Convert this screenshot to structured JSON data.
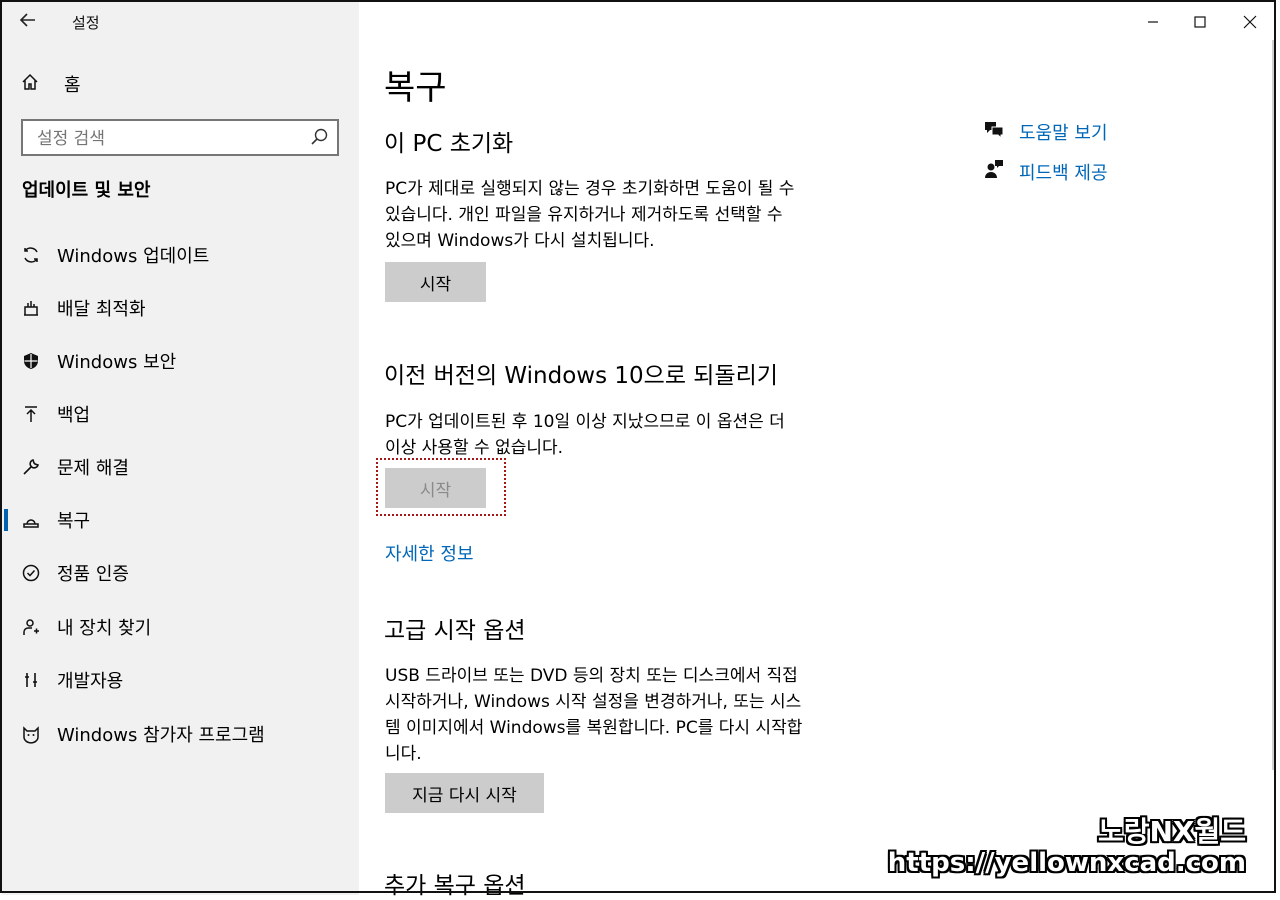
{
  "window": {
    "title": "설정",
    "controls": {
      "minimize": "—",
      "maximize": "☐",
      "close": "✕"
    }
  },
  "sidebar": {
    "home_label": "홈",
    "search_placeholder": "설정 검색",
    "section_title": "업데이트 및 보안",
    "items": [
      {
        "label": "Windows 업데이트",
        "icon": "refresh-icon"
      },
      {
        "label": "배달 최적화",
        "icon": "delivery-icon"
      },
      {
        "label": "Windows 보안",
        "icon": "shield-icon"
      },
      {
        "label": "백업",
        "icon": "backup-arrow-icon"
      },
      {
        "label": "문제 해결",
        "icon": "wrench-icon"
      },
      {
        "label": "복구",
        "icon": "recovery-icon",
        "active": true
      },
      {
        "label": "정품 인증",
        "icon": "check-circle-icon"
      },
      {
        "label": "내 장치 찾기",
        "icon": "person-locate-icon"
      },
      {
        "label": "개발자용",
        "icon": "developer-icon"
      },
      {
        "label": "Windows 참가자 프로그램",
        "icon": "insider-cat-icon"
      }
    ]
  },
  "main": {
    "page_title": "복구",
    "reset": {
      "heading": "이 PC 초기화",
      "line1": "PC가 제대로 실행되지 않는 경우 초기화하면 도움이 될 수",
      "line2": "있습니다. 개인 파일을 유지하거나 제거하도록 선택할 수",
      "line3": "있으며 Windows가 다시 설치됩니다.",
      "button": "시작"
    },
    "rollback": {
      "heading": "이전 버전의 Windows 10으로 되돌리기",
      "line1": "PC가 업데이트된 후 10일 이상 지났으므로 이 옵션은 더",
      "line2": "이상 사용할 수 없습니다.",
      "button": "시작",
      "link": "자세한 정보"
    },
    "advanced": {
      "heading": "고급 시작 옵션",
      "line1": "USB 드라이브 또는 DVD 등의 장치 또는 디스크에서 직접",
      "line2": "시작하거나, Windows 시작 설정을 변경하거나, 또는 시스",
      "line3": "템 이미지에서 Windows를 복원합니다. PC를 다시 시작합",
      "line4": "니다.",
      "button": "지금 다시 시작"
    },
    "more": {
      "heading": "추가 복구 옵션"
    }
  },
  "help": {
    "get_help": "도움말 보기",
    "feedback": "피드백 제공"
  },
  "watermark": {
    "line1": "노랑NX월드",
    "line2": "https://yellownxcad.com"
  },
  "colors": {
    "accent": "#0067b8",
    "highlight_box": "#a51616"
  }
}
